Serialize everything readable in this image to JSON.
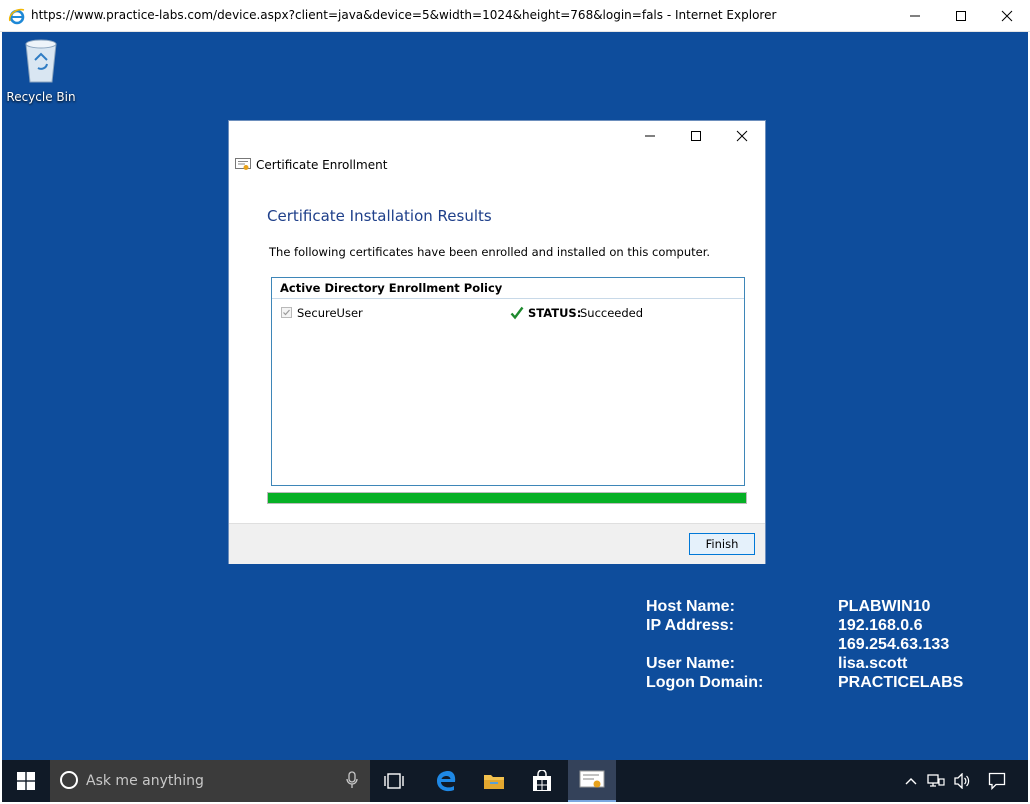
{
  "browser": {
    "title": "https://www.practice-labs.com/device.aspx?client=java&device=5&width=1024&height=768&login=fals - Internet Explorer",
    "icon": "ie-icon"
  },
  "desktop": {
    "recycle_bin_label": "Recycle Bin",
    "background_color": "#0e4d9c"
  },
  "dialog": {
    "app_title": "Certificate Enrollment",
    "heading": "Certificate Installation Results",
    "description": "The following certificates have been enrolled and installed on this computer.",
    "policy_header": "Active Directory Enrollment Policy",
    "certificates": [
      {
        "name": "SecureUser",
        "checked": true,
        "status_label": "STATUS:",
        "status_value": "Succeeded"
      }
    ],
    "progress_percent": 100,
    "finish_label": "Finish"
  },
  "bginfo": [
    {
      "label": "Host Name:",
      "value": "PLABWIN10"
    },
    {
      "label": "IP Address:",
      "value": "192.168.0.6"
    },
    {
      "label": "",
      "value": "169.254.63.133"
    },
    {
      "label": "User Name:",
      "value": "lisa.scott"
    },
    {
      "label": "Logon Domain:",
      "value": "PRACTICELABS"
    }
  ],
  "taskbar": {
    "search_placeholder": "Ask me anything",
    "apps": [
      "task-view-icon",
      "edge-icon",
      "file-explorer-icon",
      "store-icon",
      "certificate-enrollment-icon"
    ],
    "tray": [
      "chevron-up-icon",
      "network-icon",
      "volume-icon",
      "notifications-icon"
    ]
  },
  "colors": {
    "accent": "#0078d7",
    "progress": "#06b025",
    "heading": "#1e3f8a",
    "taskbar": "#101a27"
  }
}
